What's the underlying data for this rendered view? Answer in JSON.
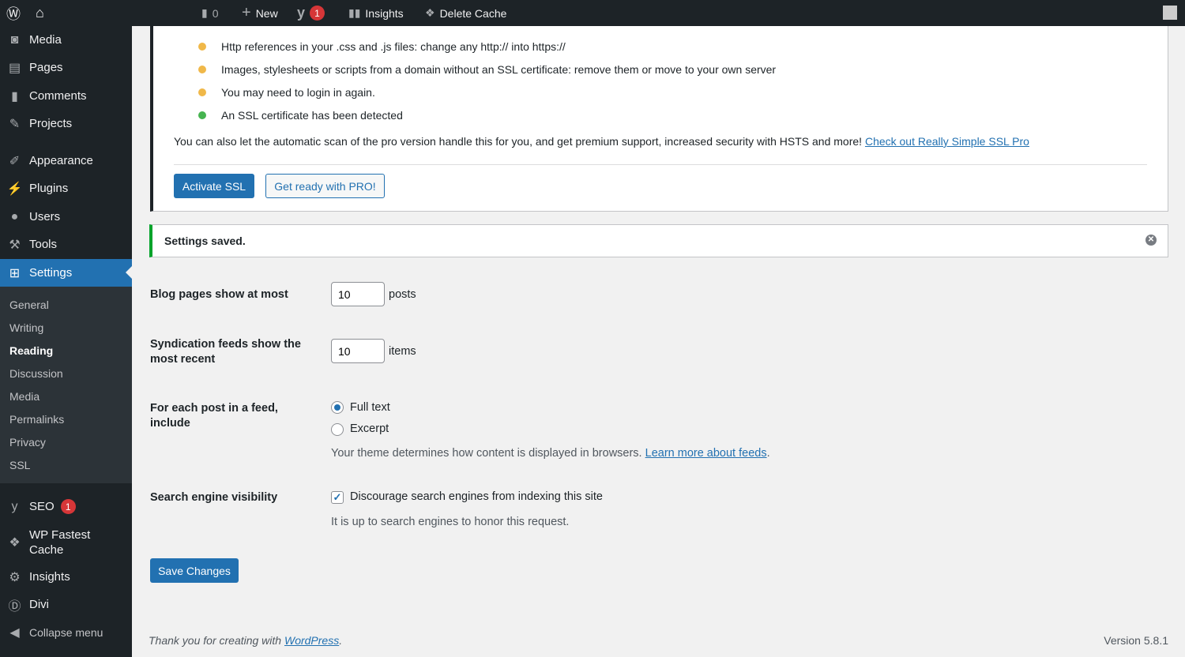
{
  "adminbar": {
    "comments_count": "0",
    "new_label": "New",
    "seo_badge": "1",
    "insights_label": "Insights",
    "delete_cache_label": "Delete Cache"
  },
  "sidebar": {
    "items": [
      {
        "label": "Media",
        "icon": "media-icon"
      },
      {
        "label": "Pages",
        "icon": "pages-icon"
      },
      {
        "label": "Comments",
        "icon": "comments-icon"
      },
      {
        "label": "Projects",
        "icon": "pin-icon"
      },
      {
        "label": "Appearance",
        "icon": "brush-icon"
      },
      {
        "label": "Plugins",
        "icon": "plugin-icon"
      },
      {
        "label": "Users",
        "icon": "user-icon"
      },
      {
        "label": "Tools",
        "icon": "wrench-icon"
      },
      {
        "label": "Settings",
        "icon": "settings-icon"
      }
    ],
    "submenu": [
      "General",
      "Writing",
      "Reading",
      "Discussion",
      "Media",
      "Permalinks",
      "Privacy",
      "SSL"
    ],
    "seo_label": "SEO",
    "seo_badge": "1",
    "wpfc_label_1": "WP Fastest",
    "wpfc_label_2": "Cache",
    "insights_label": "Insights",
    "divi_label": "Divi",
    "collapse_label": "Collapse menu"
  },
  "ssl": {
    "items": [
      {
        "text": "Http references in your .css and .js files: change any http:// into https://",
        "color": "#f0b849"
      },
      {
        "text": "Images, stylesheets or scripts from a domain without an SSL certificate: remove them or move to your own server",
        "color": "#f0b849"
      },
      {
        "text": "You may need to login in again.",
        "color": "#f0b849"
      },
      {
        "text": "An SSL certificate has been detected",
        "color": "#46b450"
      }
    ],
    "pro_text": "You can also let the automatic scan of the pro version handle this for you, and get premium support, increased security with HSTS and more!",
    "pro_link": "Check out Really Simple SSL Pro",
    "activate_label": "Activate SSL",
    "pro_button_label": "Get ready with PRO!"
  },
  "notice": {
    "text": "Settings saved."
  },
  "form": {
    "blog_pages_label": "Blog pages show at most",
    "blog_pages_value": "10",
    "blog_pages_unit": "posts",
    "feeds_label": "Syndication feeds show the most recent",
    "feeds_value": "10",
    "feeds_unit": "items",
    "feed_include_label": "For each post in a feed, include",
    "full_text": "Full text",
    "excerpt": "Excerpt",
    "feed_desc": "Your theme determines how content is displayed in browsers.",
    "feed_link": "Learn more about feeds",
    "search_label": "Search engine visibility",
    "search_checkbox": "Discourage search engines from indexing this site",
    "search_checked": true,
    "search_desc": "It is up to search engines to honor this request.",
    "save_label": "Save Changes"
  },
  "footer": {
    "thanks": "Thank you for creating with",
    "wp_link": "WordPress",
    "version": "Version 5.8.1"
  }
}
